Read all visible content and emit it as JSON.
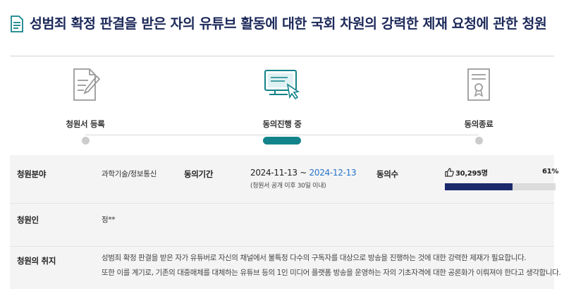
{
  "title": "성범죄 확정 판결을 받은 자의 유튜브 활동에 대한 국회 차원의 강력한 제재 요청에 관한 청원",
  "steps": [
    {
      "label": "청원서 등록",
      "icon": "document-write-icon",
      "state": "done"
    },
    {
      "label": "동의진행 중",
      "icon": "computer-click-icon",
      "state": "active"
    },
    {
      "label": "동의종료",
      "icon": "certificate-icon",
      "state": "pending"
    }
  ],
  "info": {
    "field_label": "청원분야",
    "field_value": "과학기술/정보통신",
    "period_label": "동의기간",
    "period_start": "2024-11-13",
    "period_sep": " ~ ",
    "period_end": "2024-12-13",
    "period_note": "(청원서 공개 이후 30일 이내)",
    "agree_label": "동의수",
    "agree_count": "30,295명",
    "agree_percent": "61%",
    "agree_progress": 0.61,
    "petitioner_label": "청원인",
    "petitioner_value": "정**",
    "purpose_label": "청원의 취지",
    "purpose_lines": [
      "성범죄 확정 판결을 받은 자가 유튜버로 자신의 채널에서 불특정 다수의 구독자를 대상으로 방송을 진행하는 것에 대한 강력한 제재가 필요합니다.",
      "또한 이를 계기로, 기존의 대중매체를 대체하는 유튜브 등의 1인 미디어 플랫폼 방송을 운영하는 자의 기초자격에 대한 공론화가 이뤄져야 한다고 생각합니다."
    ]
  },
  "colors": {
    "accent": "#12838a",
    "title": "#1d2a5a",
    "bar": "#1c2a6b",
    "date_end": "#2473c9"
  }
}
